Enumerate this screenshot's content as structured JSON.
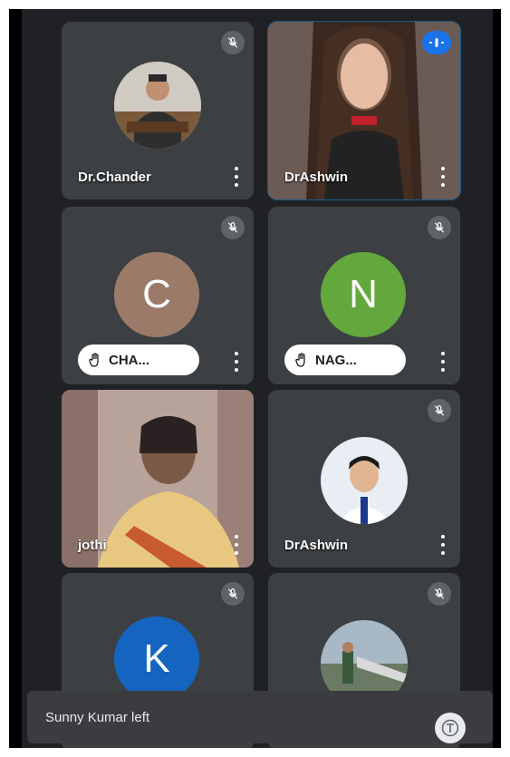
{
  "participants": [
    {
      "name": "Dr.Chander",
      "muted": true
    },
    {
      "name": "DrAshwin",
      "speaking": true
    },
    {
      "name": "CHA...",
      "initial": "C",
      "avatar_color": "#9c7a6a",
      "hand_raised": true,
      "muted": true
    },
    {
      "name": "NAG...",
      "initial": "N",
      "avatar_color": "#62a83c",
      "hand_raised": true,
      "muted": true
    },
    {
      "name": "jothi"
    },
    {
      "name": "DrAshwin",
      "muted": true
    },
    {
      "initial": "K",
      "avatar_color": "#1565c0",
      "muted": true
    },
    {
      "muted": true
    }
  ],
  "toast": {
    "message": "Sunny Kumar left"
  },
  "colors": {
    "stage": "#1f2124",
    "tile": "#3c4043",
    "speaking": "#1a73e8"
  },
  "icons": [
    "mic-off-icon",
    "audio-wave-icon",
    "more-vert-icon",
    "raise-hand-icon",
    "captions-icon"
  ]
}
